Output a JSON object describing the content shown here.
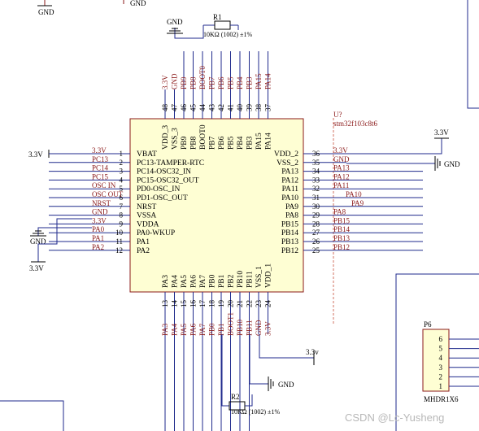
{
  "top_labels": {
    "gnd_left": "GND",
    "gnd_right": "GND"
  },
  "chip": {
    "ref": "U?",
    "part": "stm32f103c8t6",
    "left_pins": [
      {
        "num": "1",
        "name": "VBAT",
        "net": "3.3V"
      },
      {
        "num": "2",
        "name": "PC13-TAMPER-RTC",
        "net": "PC13"
      },
      {
        "num": "3",
        "name": "PC14-OSC32_IN",
        "net": "PC14"
      },
      {
        "num": "4",
        "name": "PC15-OSC32_OUT",
        "net": "PC15"
      },
      {
        "num": "5",
        "name": "PD0-OSC_IN",
        "net": "OSC IN"
      },
      {
        "num": "6",
        "name": "PD1-OSC_OUT",
        "net": "OSC OUT"
      },
      {
        "num": "7",
        "name": "NRST",
        "net": "NRST"
      },
      {
        "num": "8",
        "name": "VSSA",
        "net": "GND"
      },
      {
        "num": "9",
        "name": "VDDA",
        "net": "3.3V"
      },
      {
        "num": "10",
        "name": "PA0-WKUP",
        "net": "PA0"
      },
      {
        "num": "11",
        "name": "PA1",
        "net": "PA1"
      },
      {
        "num": "12",
        "name": "PA2",
        "net": "PA2"
      }
    ],
    "right_pins": [
      {
        "num": "36",
        "name": "VDD_2",
        "net": "3.3V"
      },
      {
        "num": "35",
        "name": "VSS_2",
        "net": "GND"
      },
      {
        "num": "34",
        "name": "PA13",
        "net": "PA13"
      },
      {
        "num": "33",
        "name": "PA12",
        "net": "PA12"
      },
      {
        "num": "32",
        "name": "PA11",
        "net": "PA11"
      },
      {
        "num": "31",
        "name": "PA10",
        "net": "PA10"
      },
      {
        "num": "30",
        "name": "PA9",
        "net": "PA9"
      },
      {
        "num": "29",
        "name": "PA8",
        "net": "PA8"
      },
      {
        "num": "28",
        "name": "PB15",
        "net": "PB15"
      },
      {
        "num": "27",
        "name": "PB14",
        "net": "PB14"
      },
      {
        "num": "26",
        "name": "PB13",
        "net": "PB13"
      },
      {
        "num": "25",
        "name": "PB12",
        "net": "PB12"
      }
    ],
    "top_pins": [
      {
        "num": "48",
        "name": "VDD_3",
        "net": "3.3V"
      },
      {
        "num": "47",
        "name": "VSS_3",
        "net": "GND"
      },
      {
        "num": "46",
        "name": "PB9",
        "net": "PB9"
      },
      {
        "num": "45",
        "name": "PB8",
        "net": "PB8"
      },
      {
        "num": "44",
        "name": "BOOT0",
        "net": "BOOT0"
      },
      {
        "num": "43",
        "name": "PB7",
        "net": "PB7"
      },
      {
        "num": "42",
        "name": "PB6",
        "net": "PB6"
      },
      {
        "num": "41",
        "name": "PB5",
        "net": "PB5"
      },
      {
        "num": "40",
        "name": "PB4",
        "net": "PB4"
      },
      {
        "num": "39",
        "name": "PB3",
        "net": "PB3"
      },
      {
        "num": "38",
        "name": "PA15",
        "net": "PA15"
      },
      {
        "num": "37",
        "name": "PA14",
        "net": "PA14"
      }
    ],
    "bottom_pins": [
      {
        "num": "13",
        "name": "PA3",
        "net": "PA3"
      },
      {
        "num": "14",
        "name": "PA4",
        "net": "PA4"
      },
      {
        "num": "15",
        "name": "PA5",
        "net": "PA5"
      },
      {
        "num": "16",
        "name": "PA6",
        "net": "PA6"
      },
      {
        "num": "17",
        "name": "PA7",
        "net": "PA7"
      },
      {
        "num": "18",
        "name": "PB0",
        "net": "PB0"
      },
      {
        "num": "19",
        "name": "PB1",
        "net": "PB1"
      },
      {
        "num": "20",
        "name": "PB2",
        "net": "BOOT1"
      },
      {
        "num": "21",
        "name": "PB10",
        "net": "PB10"
      },
      {
        "num": "22",
        "name": "PB11",
        "net": "PB11"
      },
      {
        "num": "23",
        "name": "VSS_1",
        "net": "GND"
      },
      {
        "num": "24",
        "name": "VDD_1",
        "net": "3.3V"
      }
    ]
  },
  "power": {
    "vcc_left_1": "3.3V",
    "vcc_left_2": "3.3V",
    "vcc_right": "3.3V",
    "vcc_bottom": "3.3v",
    "gnd_top": "GND",
    "gnd_left": "GND",
    "gnd_right": "GND",
    "gnd_bottom": "GND"
  },
  "resistors": {
    "r1": {
      "ref": "R1",
      "value": "10KΩ (1002) ±1%"
    },
    "r2": {
      "ref": "R2",
      "value": "10KΩ (1002) ±1%"
    }
  },
  "connector": {
    "ref": "P6",
    "part": "MHDR1X6",
    "pins": [
      "6",
      "5",
      "4",
      "3",
      "2",
      "1"
    ]
  },
  "watermark": "CSDN @Lc-Yusheng"
}
